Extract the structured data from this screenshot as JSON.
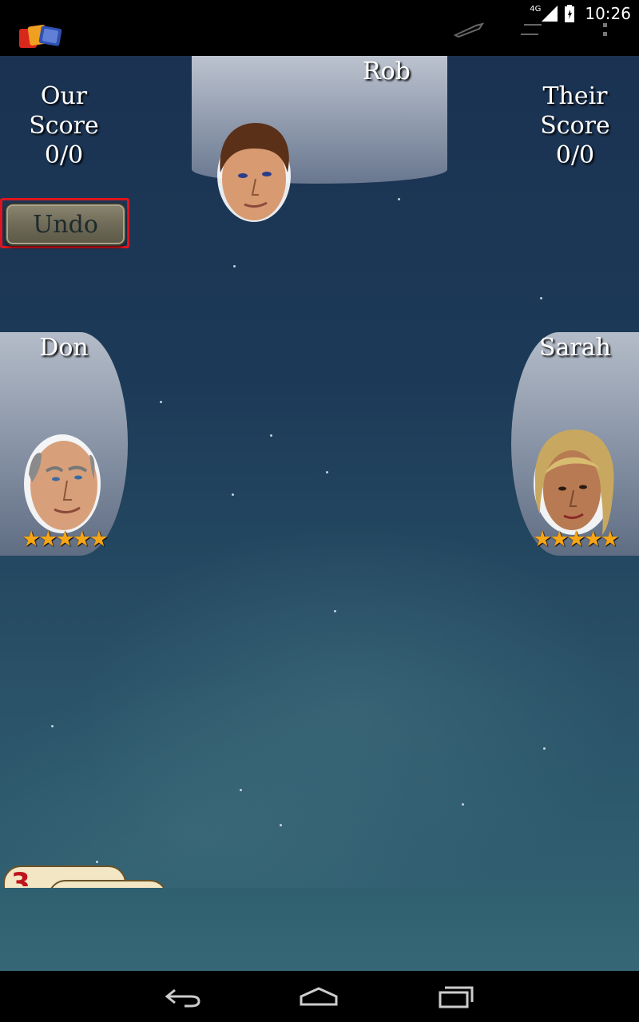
{
  "status_bar": {
    "network": "4G",
    "time": "10:26"
  },
  "scores": {
    "ours": {
      "line1": "Our",
      "line2": "Score",
      "value": "0/0"
    },
    "theirs": {
      "line1": "Their",
      "line2": "Score",
      "value": "0/0"
    }
  },
  "controls": {
    "undo_label": "Undo"
  },
  "players": {
    "top": {
      "name": "Rob"
    },
    "left": {
      "name": "Don",
      "rating": "★★★★★"
    },
    "right": {
      "name": "Sarah",
      "rating": "★★★★★"
    }
  },
  "hand": {
    "first_card_rank": "3"
  },
  "icons": {
    "app": "card-game-app-icon",
    "action_1": "pen-icon",
    "action_2": "menu-lines-icon",
    "action_3": "overflow-icon",
    "nav_back": "back-icon",
    "nav_home": "home-icon",
    "nav_recents": "recents-icon"
  },
  "colors": {
    "undo_highlight": "#e0141c",
    "star_rating": "#f5a616",
    "card_rank": "#c0141c"
  }
}
